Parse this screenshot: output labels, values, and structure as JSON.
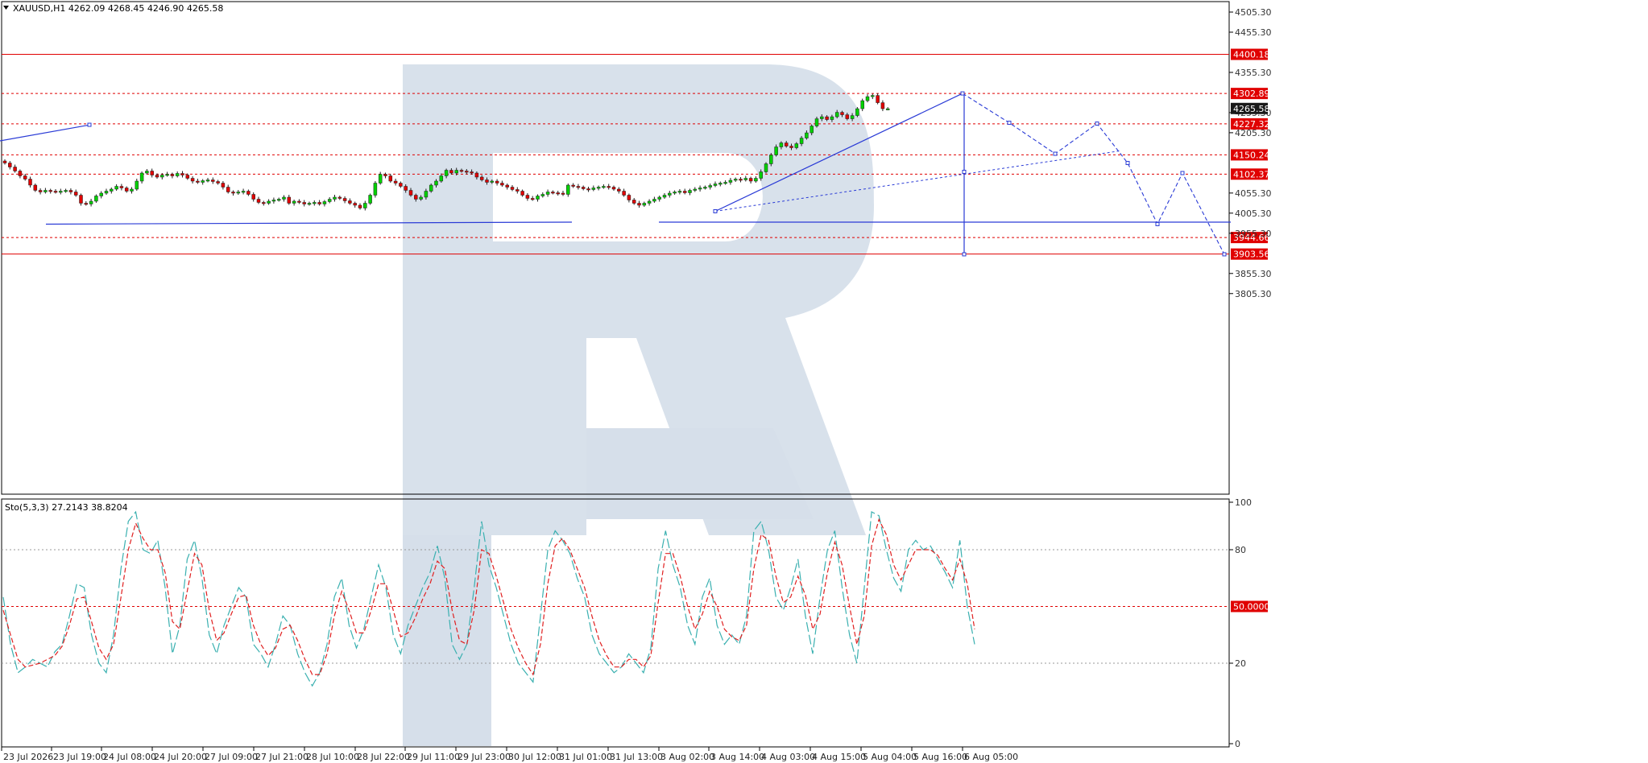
{
  "window": {
    "symbol_header": "XAUUSD,H1  4262.09 4268.45 4246.90 4265.58",
    "indicator_header": "Sto(5,3,3) 27.2143 38.8204"
  },
  "colors": {
    "bull": "#00d000",
    "bear": "#e00000",
    "level_line": "#e00000",
    "forecast": "#2a3bd6",
    "stoch_main": "#3ab0b0",
    "stoch_signal": "#e02020",
    "watermark": "#d6dfea",
    "price_tag_dark": "#1a1a1a"
  },
  "icons": {
    "dropdown": "triangle-down-icon"
  },
  "chart_data": [
    {
      "type": "candlestick",
      "title": "XAUUSD,H1",
      "ylim": [
        3580,
        4590
      ],
      "y_ticks": [
        "4505.30",
        "4455.30",
        "4355.30",
        "4255.30",
        "4205.30",
        "4055.30",
        "4005.30",
        "3955.30",
        "3855.30",
        "3805.30"
      ],
      "y_tick_values": [
        4505.3,
        4455.3,
        4355.3,
        4255.3,
        4205.3,
        4055.3,
        4005.3,
        3955.3,
        3855.3,
        3805.3
      ],
      "x_ticks": [
        "23 Jul 2026",
        "23 Jul 19:00",
        "24 Jul 08:00",
        "24 Jul 20:00",
        "27 Jul 09:00",
        "27 Jul 21:00",
        "28 Jul 10:00",
        "28 Jul 22:00",
        "29 Jul 11:00",
        "29 Jul 23:00",
        "30 Jul 12:00",
        "31 Jul 01:00",
        "31 Jul 13:00",
        "3 Aug 02:00",
        "3 Aug 14:00",
        "4 Aug 03:00",
        "4 Aug 15:00",
        "5 Aug 04:00",
        "5 Aug 16:00",
        "6 Aug 05:00"
      ],
      "current_price": "4265.58",
      "current_price_value": 4265.58,
      "levels": [
        {
          "label": "4400.18",
          "value": 4400.18,
          "style": "solid"
        },
        {
          "label": "4302.89",
          "value": 4302.89,
          "style": "dotted"
        },
        {
          "label": "4227.32",
          "value": 4227.32,
          "style": "dotted"
        },
        {
          "label": "4150.24",
          "value": 4150.24,
          "style": "dotted"
        },
        {
          "label": "4102.37",
          "value": 4102.37,
          "style": "dotted"
        },
        {
          "label": "3944.66",
          "value": 3944.66,
          "style": "dotted"
        },
        {
          "label": "3903.56",
          "value": 3903.56,
          "style": "solid"
        }
      ],
      "closes": [
        4130,
        4120,
        4110,
        4098,
        4090,
        4075,
        4062,
        4058,
        4062,
        4060,
        4058,
        4060,
        4062,
        4058,
        4050,
        4030,
        4028,
        4035,
        4048,
        4055,
        4060,
        4065,
        4072,
        4068,
        4060,
        4065,
        4085,
        4105,
        4110,
        4100,
        4095,
        4100,
        4102,
        4098,
        4104,
        4100,
        4092,
        4085,
        4082,
        4086,
        4088,
        4084,
        4080,
        4070,
        4058,
        4055,
        4058,
        4060,
        4052,
        4040,
        4032,
        4030,
        4035,
        4038,
        4040,
        4045,
        4030,
        4035,
        4032,
        4028,
        4030,
        4032,
        4028,
        4034,
        4040,
        4045,
        4042,
        4036,
        4030,
        4025,
        4018,
        4030,
        4050,
        4080,
        4102,
        4098,
        4085,
        4080,
        4072,
        4062,
        4050,
        4040,
        4045,
        4060,
        4075,
        4085,
        4098,
        4112,
        4105,
        4112,
        4110,
        4108,
        4105,
        4095,
        4088,
        4082,
        4085,
        4080,
        4075,
        4070,
        4064,
        4060,
        4050,
        4042,
        4040,
        4048,
        4052,
        4058,
        4056,
        4055,
        4052,
        4075,
        4072,
        4070,
        4066,
        4064,
        4068,
        4070,
        4072,
        4070,
        4065,
        4060,
        4050,
        4038,
        4030,
        4025,
        4030,
        4035,
        4040,
        4045,
        4050,
        4055,
        4058,
        4060,
        4056,
        4062,
        4065,
        4068,
        4070,
        4074,
        4078,
        4080,
        4082,
        4087,
        4090,
        4088,
        4092,
        4085,
        4092,
        4108,
        4128,
        4150,
        4170,
        4180,
        4172,
        4168,
        4178,
        4192,
        4205,
        4222,
        4240,
        4245,
        4238,
        4245,
        4256,
        4250,
        4240,
        4248,
        4265,
        4285,
        4295,
        4298,
        4280,
        4265,
        4265
      ],
      "forecast_path": {
        "points": [
          [
            888,
            4010
          ],
          [
            1195,
            4303
          ],
          [
            1253,
            4230
          ],
          [
            1310,
            4153
          ],
          [
            1362,
            4228
          ],
          [
            1400,
            4130
          ],
          [
            1437,
            3978
          ],
          [
            1468,
            4105
          ],
          [
            1520,
            3903
          ]
        ],
        "projection_start": [
          888,
          4010
        ],
        "projection_end": [
          1390,
          4160
        ],
        "target_vertical": [
          [
            1197,
            4303
          ],
          [
            1197,
            3903
          ]
        ]
      },
      "trend_lines": [
        {
          "from": [
            0,
            4185
          ],
          "to": [
            112,
            4225
          ]
        },
        {
          "from": [
            57,
            3978
          ],
          "to": [
            710,
            3983
          ]
        },
        {
          "from": [
            818,
            3983
          ],
          "to": [
            1528,
            3983
          ]
        }
      ]
    },
    {
      "type": "line",
      "title": "Sto(5,3,3) 27.2143 38.8204",
      "ylim": [
        0,
        100
      ],
      "y_ticks": [
        "100",
        "80",
        "50.0000",
        "20",
        "0"
      ],
      "y_tick_values": [
        100,
        80,
        50,
        20,
        0
      ],
      "main_line_values": [
        55,
        30,
        15,
        18,
        22,
        20,
        18,
        26,
        30,
        45,
        62,
        60,
        35,
        20,
        15,
        35,
        70,
        95,
        100,
        80,
        78,
        85,
        60,
        25,
        40,
        75,
        85,
        65,
        35,
        25,
        40,
        50,
        60,
        55,
        30,
        25,
        18,
        30,
        45,
        40,
        25,
        15,
        8,
        15,
        30,
        55,
        65,
        40,
        28,
        38,
        55,
        72,
        60,
        35,
        25,
        40,
        50,
        60,
        68,
        82,
        65,
        30,
        22,
        30,
        60,
        95,
        72,
        60,
        45,
        30,
        20,
        15,
        10,
        45,
        80,
        90,
        85,
        78,
        65,
        55,
        35,
        25,
        20,
        15,
        18,
        25,
        20,
        15,
        28,
        70,
        90,
        72,
        60,
        40,
        30,
        55,
        65,
        40,
        30,
        35,
        30,
        45,
        90,
        95,
        80,
        55,
        48,
        60,
        75,
        45,
        25,
        55,
        80,
        90,
        60,
        35,
        20,
        60,
        100,
        98,
        80,
        65,
        58,
        80,
        85,
        80,
        82,
        75,
        68,
        60,
        85,
        50,
        30
      ],
      "signal_line_values": [
        48,
        35,
        22,
        18,
        19,
        20,
        22,
        24,
        29,
        40,
        54,
        55,
        42,
        28,
        22,
        30,
        55,
        80,
        94,
        86,
        80,
        80,
        68,
        42,
        38,
        58,
        78,
        72,
        48,
        32,
        36,
        46,
        55,
        56,
        40,
        30,
        24,
        28,
        38,
        40,
        32,
        22,
        14,
        14,
        25,
        45,
        58,
        48,
        36,
        36,
        48,
        62,
        62,
        48,
        34,
        36,
        44,
        54,
        62,
        74,
        70,
        48,
        32,
        30,
        48,
        80,
        78,
        66,
        52,
        38,
        28,
        20,
        14,
        30,
        62,
        82,
        86,
        80,
        70,
        60,
        45,
        32,
        24,
        18,
        18,
        22,
        22,
        18,
        24,
        52,
        78,
        78,
        66,
        50,
        38,
        46,
        58,
        50,
        38,
        34,
        32,
        40,
        70,
        88,
        85,
        66,
        52,
        55,
        66,
        56,
        38,
        46,
        68,
        84,
        72,
        50,
        30,
        45,
        82,
        96,
        88,
        72,
        64,
        72,
        80,
        80,
        80,
        77,
        70,
        64,
        75,
        62,
        38
      ]
    }
  ]
}
